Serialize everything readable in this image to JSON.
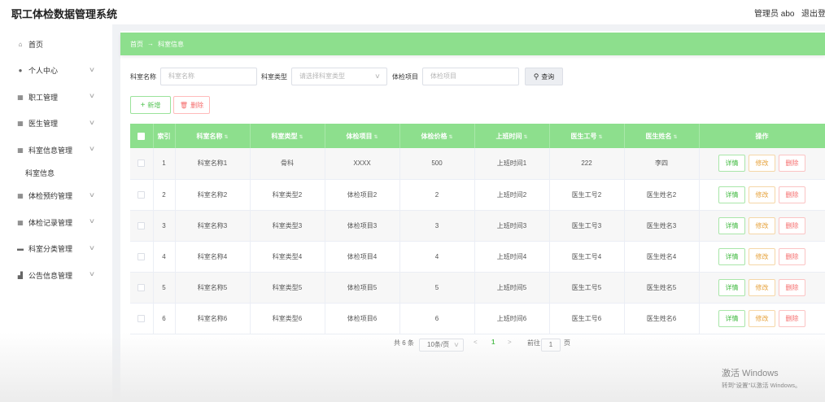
{
  "header": {
    "title": "职工体检数据管理系统",
    "user": "管理员 abo",
    "logout": "退出登录"
  },
  "sidebar": {
    "items": [
      {
        "label": "首页",
        "icon": "home-icon",
        "glyph": "⌂",
        "expandable": false
      },
      {
        "label": "个人中心",
        "icon": "user-icon",
        "glyph": "●",
        "expandable": true
      },
      {
        "label": "职工管理",
        "icon": "grid-icon",
        "glyph": "▦",
        "expandable": true
      },
      {
        "label": "医生管理",
        "icon": "grid-icon",
        "glyph": "▦",
        "expandable": true
      },
      {
        "label": "科室信息管理",
        "icon": "grid-icon",
        "glyph": "▦",
        "expandable": true,
        "expanded": true,
        "children": [
          "科室信息"
        ]
      },
      {
        "label": "体检预约管理",
        "icon": "grid-icon",
        "glyph": "▦",
        "expandable": true
      },
      {
        "label": "体检记录管理",
        "icon": "grid-icon",
        "glyph": "▦",
        "expandable": true
      },
      {
        "label": "科室分类管理",
        "icon": "message-icon",
        "glyph": "▬",
        "expandable": true
      },
      {
        "label": "公告信息管理",
        "icon": "chart-icon",
        "glyph": "▟",
        "expandable": true
      }
    ]
  },
  "breadcrumb": {
    "home": "首页",
    "arrow": "→",
    "current": "科室信息"
  },
  "search": {
    "name_label": "科室名称",
    "name_placeholder": "科室名称",
    "type_label": "科室类型",
    "type_placeholder": "请选择科室类型",
    "item_label": "体检项目",
    "item_placeholder": "体检项目",
    "query_button": "查询"
  },
  "toolbar": {
    "add_label": "新增",
    "delete_label": "删除"
  },
  "table": {
    "columns": [
      "索引",
      "科室名称",
      "科室类型",
      "体检项目",
      "体检价格",
      "上班时间",
      "医生工号",
      "医生姓名",
      "操作"
    ],
    "rows": [
      {
        "index": "1",
        "name": "科室名称1",
        "type": "骨科",
        "item": "XXXX",
        "price": "500",
        "time": "上班时间1",
        "doctor_id": "222",
        "doctor_name": "李四"
      },
      {
        "index": "2",
        "name": "科室名称2",
        "type": "科室类型2",
        "item": "体检项目2",
        "price": "2",
        "time": "上班时间2",
        "doctor_id": "医生工号2",
        "doctor_name": "医生姓名2"
      },
      {
        "index": "3",
        "name": "科室名称3",
        "type": "科室类型3",
        "item": "体检项目3",
        "price": "3",
        "time": "上班时间3",
        "doctor_id": "医生工号3",
        "doctor_name": "医生姓名3"
      },
      {
        "index": "4",
        "name": "科室名称4",
        "type": "科室类型4",
        "item": "体检项目4",
        "price": "4",
        "time": "上班时间4",
        "doctor_id": "医生工号4",
        "doctor_name": "医生姓名4"
      },
      {
        "index": "5",
        "name": "科室名称5",
        "type": "科室类型5",
        "item": "体检项目5",
        "price": "5",
        "time": "上班时间5",
        "doctor_id": "医生工号5",
        "doctor_name": "医生姓名5"
      },
      {
        "index": "6",
        "name": "科室名称6",
        "type": "科室类型6",
        "item": "体检项目6",
        "price": "6",
        "time": "上班时间6",
        "doctor_id": "医生工号6",
        "doctor_name": "医生姓名6"
      }
    ],
    "actions": {
      "detail": "详情",
      "edit": "修改",
      "remove": "删除"
    }
  },
  "pagination": {
    "total": "共 6 条",
    "page_size": "10条/页",
    "prev": "<",
    "current_page": "1",
    "next": ">",
    "goto_label": "前往",
    "goto_value": "1",
    "goto_unit": "页"
  },
  "watermark": {
    "line1": "激活 Windows",
    "line2": "转到“设置”以激活 Windows。"
  },
  "colors": {
    "accent": "#8ddf8d",
    "danger": "#f56c6c",
    "warning": "#e6a23c"
  }
}
